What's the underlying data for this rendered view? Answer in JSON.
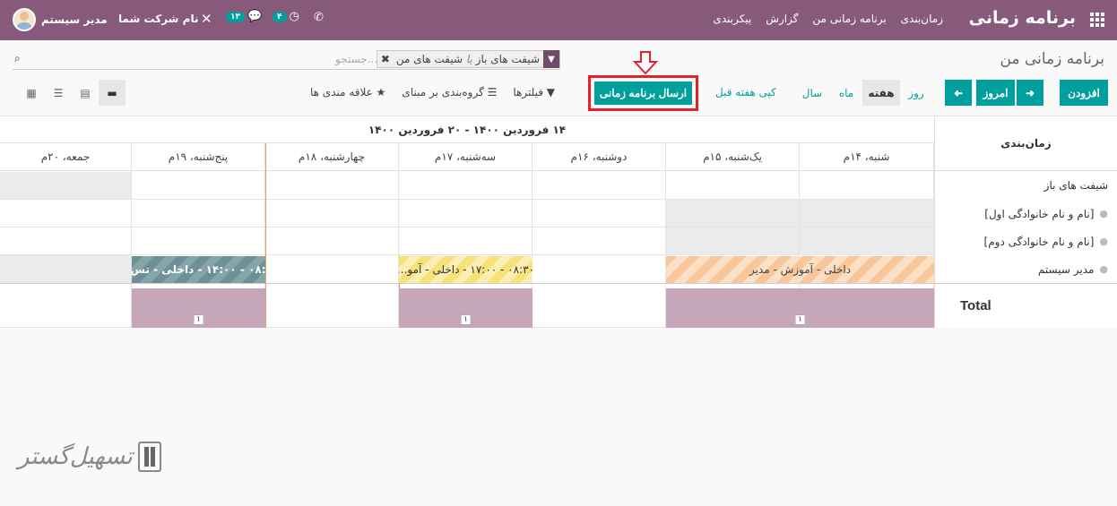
{
  "topbar": {
    "brand": "برنامه زمانی",
    "menu": [
      "زمان‌بندی",
      "برنامه زمانی من",
      "گزارش",
      "پیکربندی"
    ],
    "user": "مدیر سیستم",
    "company": "نام شرکت شما",
    "chat_count": "۱۳",
    "activity_count": "۴"
  },
  "breadcrumb": "برنامه زمانی من",
  "search": {
    "facet_main": "شیفت های باز",
    "facet_sep": "یا",
    "facet_tail": "شیفت های من",
    "placeholder": "جستجو..."
  },
  "toolbar": {
    "add": "افزودن",
    "today": "امروز",
    "scales": [
      "روز",
      "هفته",
      "ماه",
      "سال"
    ],
    "active_scale": "هفته",
    "copy_prev_week": "کپی هفته قبل",
    "send_schedule": "ارسال برنامه زمانی",
    "filters": "فیلترها",
    "group_by": "گروه‌بندی بر مبنای",
    "favorites": "علاقه مندی ها"
  },
  "gantt": {
    "title": "زمان‌بندی",
    "range": "۱۴ فروردین ۱۴۰۰ - ۲۰ فروردین ۱۴۰۰",
    "days": [
      "شنبه، ۱۴م",
      "یک‌شنبه، ۱۵م",
      "دوشنبه، ۱۶م",
      "سه‌شنبه، ۱۷م",
      "چهارشنبه، ۱۸م",
      "پنج‌شنبه، ۱۹م",
      "جمعه، ۲۰م"
    ],
    "rows": [
      "شیفت های باز",
      "[نام و نام خانوادگی اول]",
      "[نام و نام خانوادگی دوم]",
      "مدیر سیستم"
    ],
    "total_label": "Total",
    "shifts": {
      "training": "داخلی - آموزش - مدیر",
      "wed": "۰۸:۳۰ - ۱۷:۰۰ - داخلی - آمو...",
      "fri": "۰۸:۳۰ - ۱۴:۰۰ - داخلی - تس..."
    },
    "totals": [
      "۱",
      "۱",
      "۱"
    ]
  },
  "watermark": "تسهیل‌گستر"
}
